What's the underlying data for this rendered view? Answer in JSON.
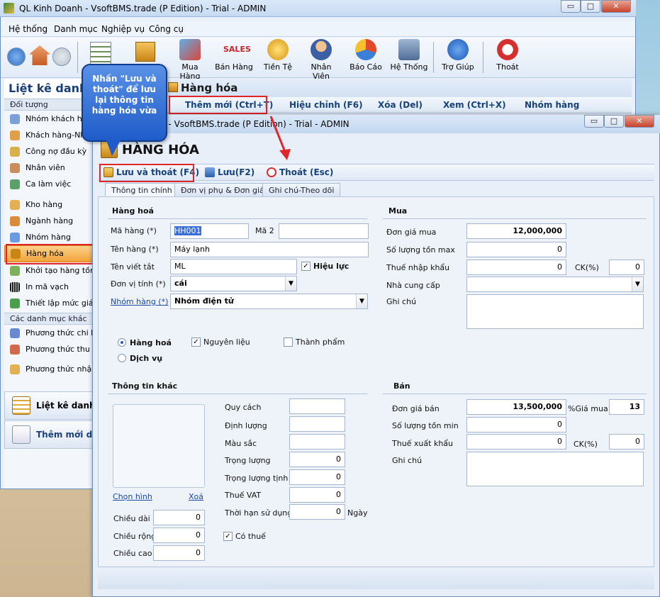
{
  "main_window": {
    "title": "QL Kinh Doanh - VsoftBMS.trade (P Edition) - Trial - ADMIN",
    "min": "▭",
    "max": "□",
    "close": "✕"
  },
  "menu": [
    "Hệ thống",
    "Danh mục",
    "Nghiệp vụ",
    "Công cụ"
  ],
  "toolbar": {
    "items": [
      "Mua Hàng",
      "Bán Hàng",
      "Tiền Tệ",
      "Nhân Viên",
      "Báo Cáo",
      "Hệ Thống",
      "Trợ Giúp",
      "Thoát"
    ],
    "sales_text": "SALES"
  },
  "left_panel": {
    "title": "Liệt kê danh",
    "section1": "Đối tượng",
    "items1": [
      "Nhóm khách hà",
      "Khách hàng-Nh",
      "Công nợ đầu kỳ",
      "Nhân viên",
      "Ca làm việc"
    ],
    "items2": [
      "Kho hàng",
      "Ngành hàng",
      "Nhóm hàng",
      "Hàng hóa",
      "Khởi tạo hàng tồn",
      "In mã vạch",
      "Thiết lập mức giá"
    ],
    "section2": "Các danh mục khác",
    "items3": [
      "Phương thức chi kh",
      "Phương thức thu kh",
      "Phương thức nhập"
    ],
    "big1": "Liệt kê danh m",
    "big2": "Thêm mới dan"
  },
  "content_header": "Hàng hóa",
  "sub_toolbar": {
    "add": "Thêm mới (Ctrl+T)",
    "edit": "Hiệu chỉnh (F6)",
    "delete": "Xóa (Del)",
    "view": "Xem (Ctrl+X)",
    "group": "Nhóm hàng"
  },
  "callout": "Nhấn \"Lưu và thoát\" để lưu lại thông tin hàng hóa vừa",
  "form": {
    "title": "h - VsoftBMS.trade (P Edition) - Trial - ADMIN",
    "heading": "HÀNG HÓA",
    "save_exit": "Lưu và thoát (F4)",
    "save": "Lưu(F2)",
    "exit": "Thoát (Esc)",
    "tabs": [
      "Thông tin chính",
      "Đơn vị phụ & Đơn giá",
      "Ghi chú-Theo dõi"
    ],
    "hang_hoa": {
      "group": "Hàng hoá",
      "ma_hang_label": "Mã hàng (*)",
      "ma_hang": "HH001",
      "ma2_label": "Mã 2",
      "ma2": "",
      "ten_hang_label": "Tên hàng (*)",
      "ten_hang": "Máy lạnh",
      "ten_viet_tat_label": "Tên viết tắt",
      "ten_viet_tat": "ML",
      "hieu_luc": "Hiệu lực",
      "don_vi_label": "Đơn vị tính (*)",
      "don_vi": "cái",
      "nhom_hang_label": "Nhóm hàng (*)",
      "nhom_hang": "Nhóm điện tử"
    },
    "type": {
      "hang_hoa": "Hàng hoá",
      "dich_vu": "Dịch vụ",
      "nguyen_lieu": "Nguyên liệu",
      "thanh_pham": "Thành phẩm",
      "check": "✓"
    },
    "mua": {
      "group": "Mua",
      "don_gia_label": "Đơn giá mua",
      "don_gia": "12,000,000",
      "ton_max_label": "Số lượng tồn max",
      "ton_max": "0",
      "thue_nk_label": "Thuế nhập khẩu",
      "thue_nk": "0",
      "ck_label": "CK(%)",
      "ck": "0",
      "ncc_label": "Nhà cung cấp",
      "ncc": "",
      "ghichu_label": "Ghi chú"
    },
    "khac": {
      "group": "Thông tin khác",
      "chon_hinh": "Chọn hình",
      "xoa": "Xoá",
      "quy_cach": "Quy cách",
      "dinh_luong": "Định lượng",
      "mau_sac": "Màu sắc",
      "trong_luong": "Trọng lượng",
      "trong_luong_val": "0",
      "trong_luong_tinh": "Trọng lượng tịnh",
      "trong_luong_tinh_val": "0",
      "thue_vat": "Thuế VAT",
      "thue_vat_val": "0",
      "thoi_han": "Thời hạn sử dụng",
      "thoi_han_val": "0",
      "ngay": "Ngày",
      "co_thue": "Có thuế",
      "chieu_dai": "Chiều dài",
      "chieu_dai_val": "0",
      "chieu_rong": "Chiều rộng",
      "chieu_rong_val": "0",
      "chieu_cao": "Chiều cao",
      "chieu_cao_val": "0"
    },
    "ban": {
      "group": "Bán",
      "don_gia_label": "Đơn giá bán",
      "don_gia": "13,500,000",
      "pct_label": "%Giá mua",
      "pct": "13",
      "ton_min_label": "Số lượng tồn min",
      "ton_min": "0",
      "thue_xk_label": "Thuế xuất khẩu",
      "thue_xk": "0",
      "ck_label": "CK(%)",
      "ck": "0",
      "ghichu_label": "Ghi chú"
    }
  }
}
